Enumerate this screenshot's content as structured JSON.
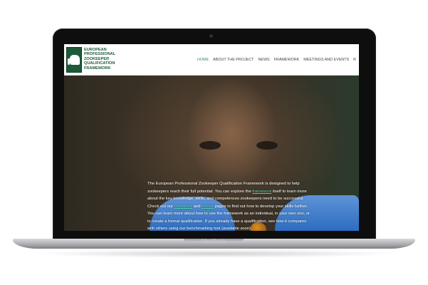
{
  "site": {
    "logo_lines": [
      "European",
      "Professional",
      "Zookeeper",
      "Qualification",
      "Framework"
    ]
  },
  "nav": {
    "items": [
      {
        "label": "HOME",
        "active": true
      },
      {
        "label": "ABOUT THE PROJECT",
        "active": false
      },
      {
        "label": "NEWS",
        "active": false
      },
      {
        "label": "FRAMEWORK",
        "active": false
      },
      {
        "label": "MEETINGS AND EVENTS",
        "active": false
      },
      {
        "label": "R",
        "active": false
      }
    ]
  },
  "hero": {
    "p1": "The European Professional Zookeeper Qualification Framework is designed to help zookeepers reach their full potential. You can explore the ",
    "link_framework": "framework",
    "p2": " itself to learn more about the key knowledge, skills, and competences zookeepers need to be successful. Check out our ",
    "link_resources": "resources",
    "p3": " and ",
    "link_events": "events",
    "p4": " pages to find out how to develop your skills further. You can learn more about how to use the framework as an individual, in your own zoo, or to create a formal qualification. If you already have a qualification, see how it compares with others using our benchmarking tool (available soon)."
  },
  "device": {
    "brand": "MacBook"
  },
  "colors": {
    "brand_green": "#1d5a39",
    "nav_active": "#2e8f6c",
    "link": "#4fd1a9"
  }
}
